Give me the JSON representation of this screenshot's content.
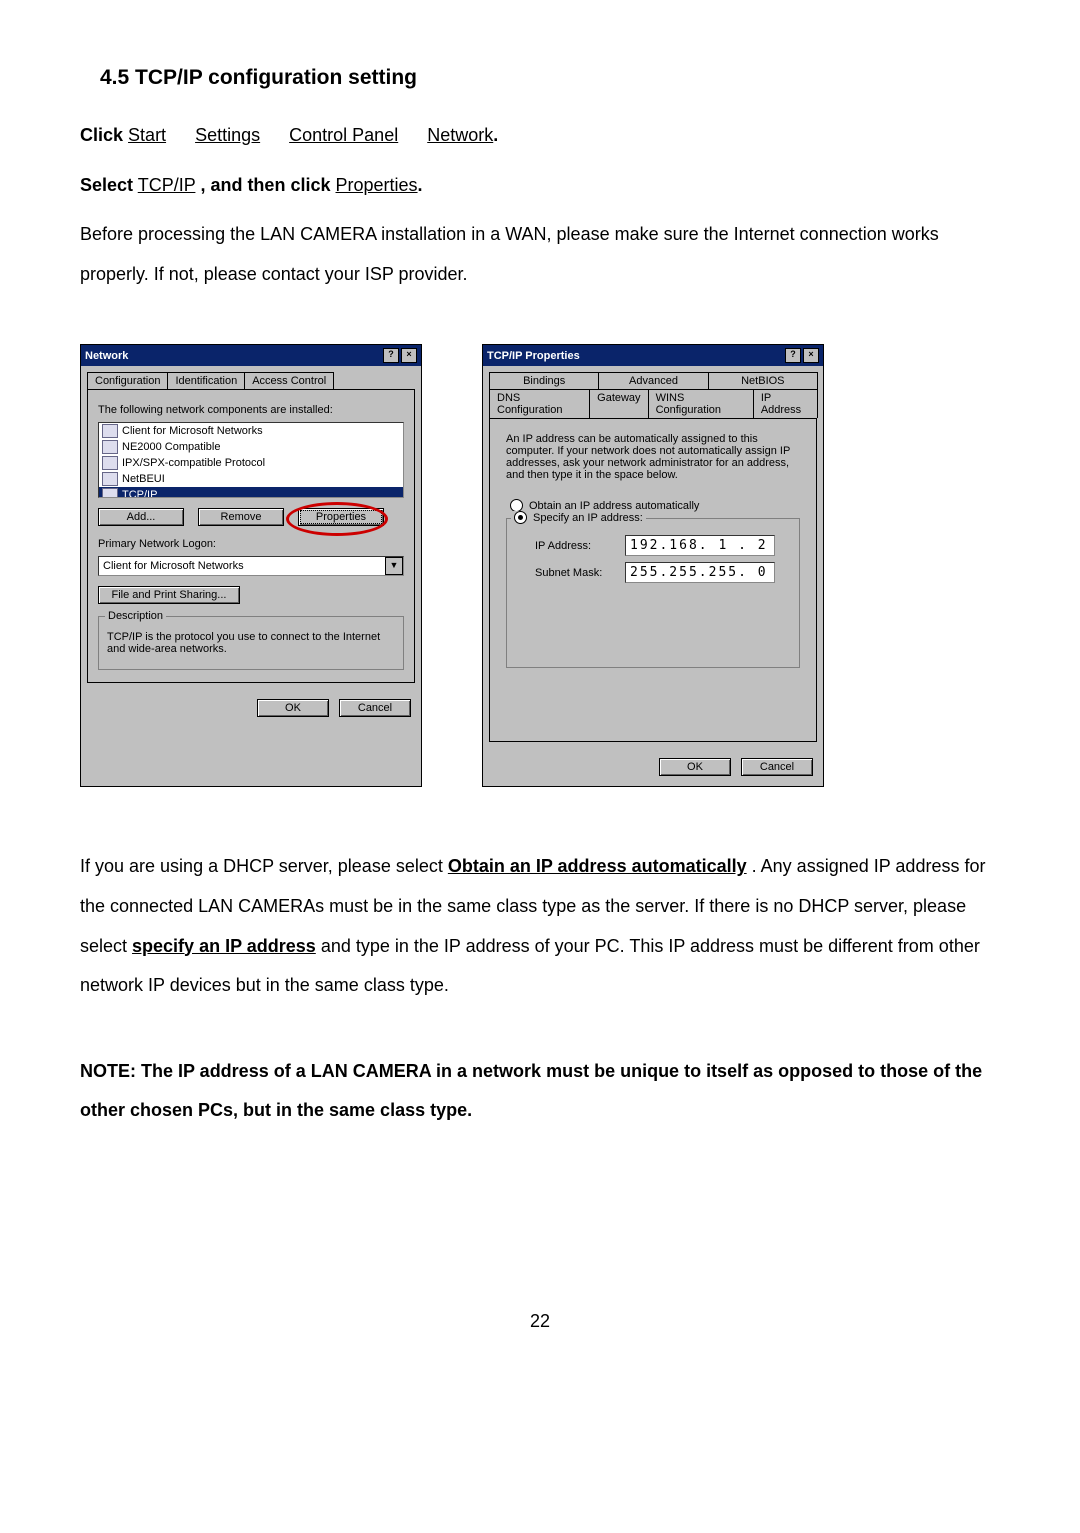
{
  "section_heading": "4.5 TCP/IP configuration setting",
  "steps": {
    "click_label": "Click",
    "path": {
      "a": "Start",
      "b": "Settings",
      "c": "Control Panel",
      "d": "Network"
    },
    "select_label": "Select",
    "tcpip": "TCP/IP",
    "then_click": ", and then click",
    "properties": "Properties"
  },
  "intro": "Before processing the LAN CAMERA installation in a WAN, please make sure the Internet connection works properly. If not, please contact your ISP provider.",
  "network_dialog": {
    "title": "Network",
    "tabs": {
      "config": "Configuration",
      "ident": "Identification",
      "access": "Access Control"
    },
    "components_label": "The following network components are installed:",
    "components": [
      "Client for Microsoft Networks",
      "NE2000 Compatible",
      "IPX/SPX-compatible Protocol",
      "NetBEUI",
      "TCP/IP"
    ],
    "buttons": {
      "add": "Add...",
      "remove": "Remove",
      "properties": "Properties"
    },
    "logon_label": "Primary Network Logon:",
    "logon_value": "Client for Microsoft Networks",
    "fps_button": "File and Print Sharing...",
    "desc_legend": "Description",
    "desc_text": "TCP/IP is the protocol you use to connect to the Internet and wide-area networks.",
    "ok": "OK",
    "cancel": "Cancel"
  },
  "tcpip_dialog": {
    "title": "TCP/IP Properties",
    "tabs_row1": {
      "bind": "Bindings",
      "adv": "Advanced",
      "netb": "NetBIOS"
    },
    "tabs_row2": {
      "dns": "DNS Configuration",
      "gw": "Gateway",
      "wins": "WINS Configuration",
      "ip": "IP Address"
    },
    "help_text": "An IP address can be automatically assigned to this computer. If your network does not automatically assign IP addresses, ask your network administrator for an address, and then type it in the space below.",
    "opt_auto": "Obtain an IP address automatically",
    "opt_spec": "Specify an IP address:",
    "ip_label": "IP Address:",
    "ip_value": "192.168. 1 . 2",
    "mask_label": "Subnet Mask:",
    "mask_value": "255.255.255. 0",
    "ok": "OK",
    "cancel": "Cancel"
  },
  "para_dhcp_1": "If you are using a DHCP server, please select ",
  "para_dhcp_link1": "Obtain an IP address automatically",
  "para_dhcp_2": ". Any assigned IP address for the connected LAN CAMERAs must be in the same class type as the server. If there is no DHCP server, please select ",
  "para_dhcp_link2": "specify an IP address",
  "para_dhcp_3": " and type in the IP address of your PC. This IP address must be different from other network IP devices but in the same class type.",
  "note": "NOTE: The IP address of a LAN CAMERA in a network must be unique to itself as opposed to those of the other chosen PCs, but in the same class type.",
  "page_number": "22"
}
